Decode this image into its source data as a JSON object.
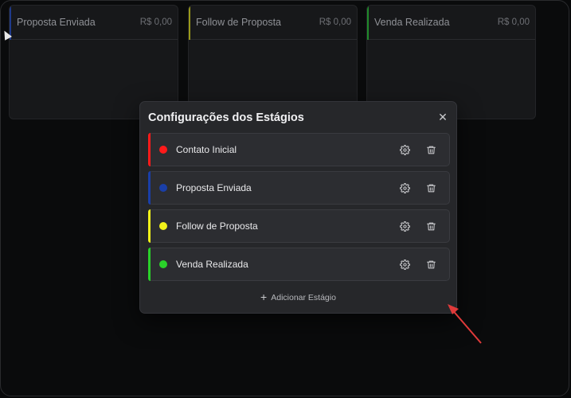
{
  "board": {
    "columns": [
      {
        "title": "Proposta Enviada",
        "amount": "R$ 0,00",
        "color": "#1f3a8a"
      },
      {
        "title": "Follow de Proposta",
        "amount": "R$ 0,00",
        "color": "#9a9a1a"
      },
      {
        "title": "Venda Realizada",
        "amount": "R$ 0,00",
        "color": "#1f8a2a"
      }
    ]
  },
  "modal": {
    "title": "Configurações dos Estágios",
    "close_icon": "close-icon",
    "stages": [
      {
        "name": "Contato Inicial",
        "color": "#ff1a1a"
      },
      {
        "name": "Proposta Enviada",
        "color": "#1a3fa8"
      },
      {
        "name": "Follow de Proposta",
        "color": "#f2f21a"
      },
      {
        "name": "Venda Realizada",
        "color": "#2ad12a"
      }
    ],
    "add_label": "Adicionar Estágio"
  },
  "annotation": {
    "arrow_color": "#e03a3a"
  }
}
